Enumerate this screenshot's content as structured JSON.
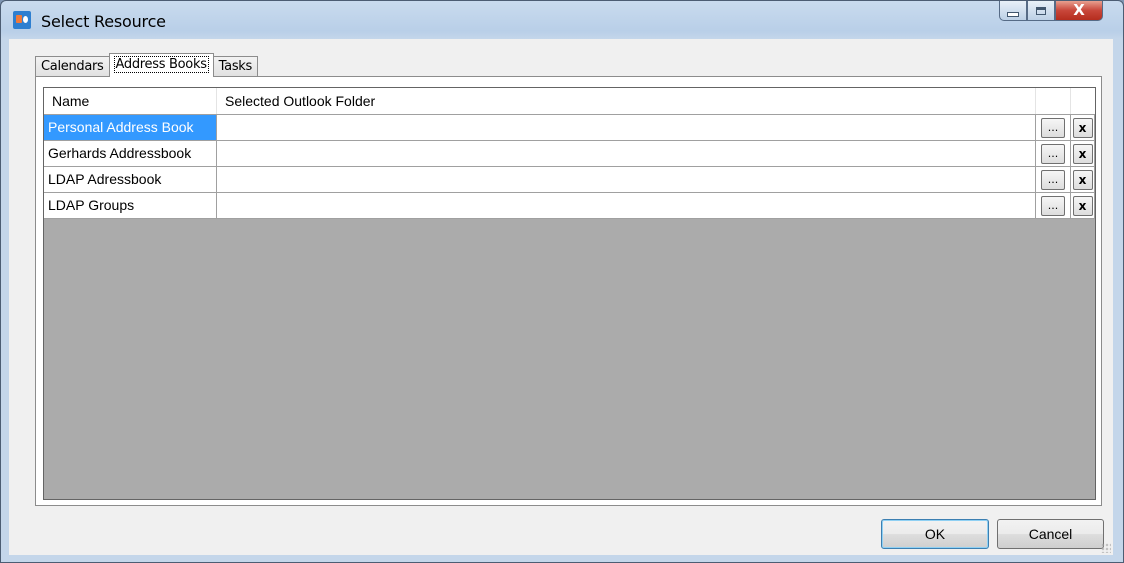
{
  "window": {
    "title": "Select Resource",
    "close_glyph": "X"
  },
  "tabs": [
    {
      "label": "Calendars",
      "active": false
    },
    {
      "label": "Address Books",
      "active": true
    },
    {
      "label": "Tasks",
      "active": false
    }
  ],
  "grid": {
    "columns": [
      "Name",
      "Selected Outlook Folder"
    ],
    "rows": [
      {
        "name": "Personal Address Book",
        "folder": "",
        "selected": true
      },
      {
        "name": "Gerhards Addressbook",
        "folder": "",
        "selected": false
      },
      {
        "name": "LDAP Adressbook",
        "folder": "",
        "selected": false
      },
      {
        "name": "LDAP Groups",
        "folder": "",
        "selected": false
      }
    ],
    "browse_label": "...",
    "clear_label": "x"
  },
  "footer": {
    "ok_label": "OK",
    "cancel_label": "Cancel"
  },
  "colors": {
    "selection": "#3399ff",
    "grid_empty": "#ababab"
  }
}
